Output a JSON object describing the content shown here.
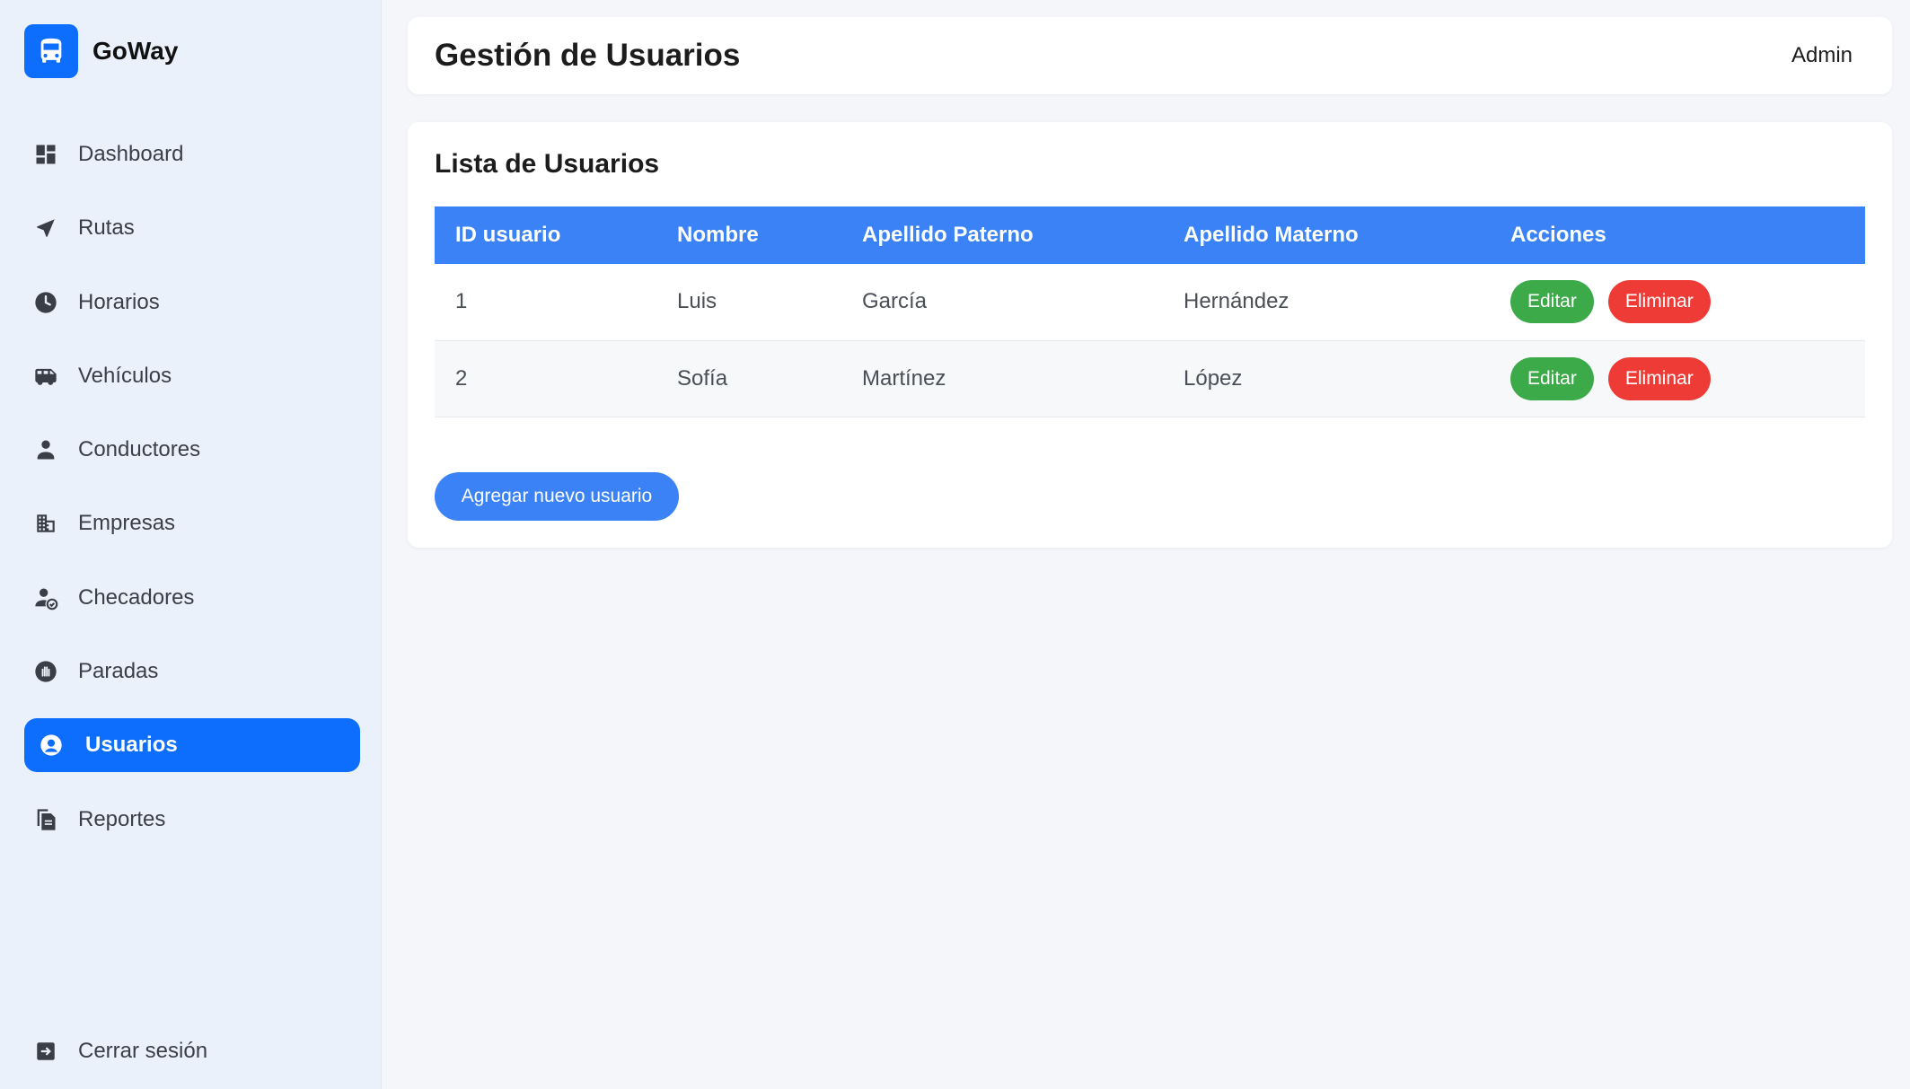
{
  "brand": {
    "name": "GoWay",
    "icon": "bus-icon",
    "color": "#0d6efd"
  },
  "sidebar": {
    "items": [
      {
        "label": "Dashboard",
        "icon": "dashboard-icon"
      },
      {
        "label": "Rutas",
        "icon": "navigation-arrow-icon"
      },
      {
        "label": "Horarios",
        "icon": "clock-icon"
      },
      {
        "label": "Vehículos",
        "icon": "bus-icon"
      },
      {
        "label": "Conductores",
        "icon": "driver-icon"
      },
      {
        "label": "Empresas",
        "icon": "building-icon"
      },
      {
        "label": "Checadores",
        "icon": "user-check-icon"
      },
      {
        "label": "Paradas",
        "icon": "hand-stop-icon"
      },
      {
        "label": "Usuarios",
        "icon": "user-circle-icon",
        "active": true
      },
      {
        "label": "Reportes",
        "icon": "documents-icon"
      }
    ],
    "logout_label": "Cerrar sesión"
  },
  "header": {
    "title": "Gestión de Usuarios",
    "user": "Admin"
  },
  "users_card": {
    "title": "Lista de Usuarios",
    "columns": [
      "ID usuario",
      "Nombre",
      "Apellido Paterno",
      "Apellido Materno",
      "Acciones"
    ],
    "rows": [
      {
        "id": "1",
        "nombre": "Luis",
        "paterno": "García",
        "materno": "Hernández"
      },
      {
        "id": "2",
        "nombre": "Sofía",
        "paterno": "Martínez",
        "materno": "López"
      }
    ],
    "edit_label": "Editar",
    "delete_label": "Eliminar",
    "add_label": "Agregar nuevo usuario"
  },
  "colors": {
    "primary": "#0d6efd",
    "table_header": "#3b82f6",
    "edit": "#3daa4a",
    "delete": "#ef3b36"
  }
}
